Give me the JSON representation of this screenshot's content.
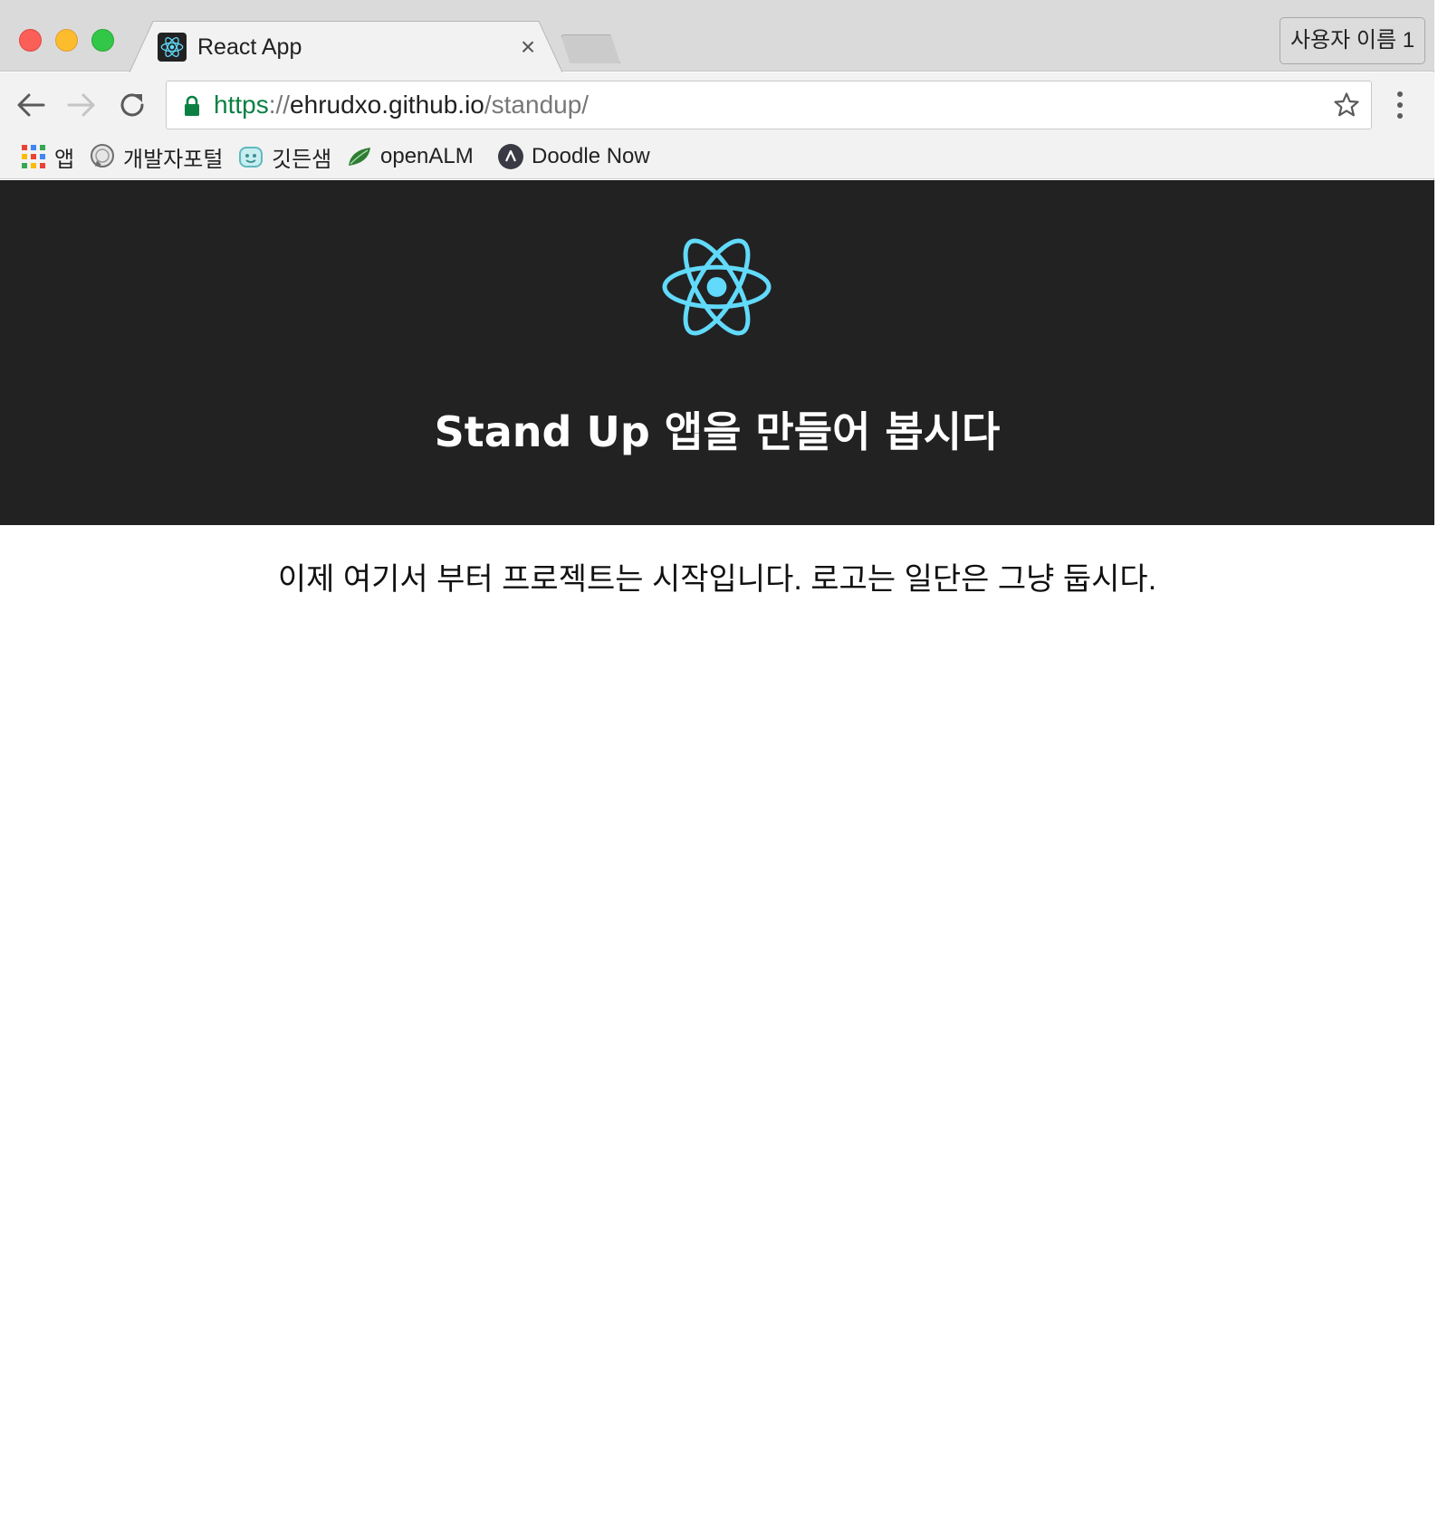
{
  "browser": {
    "tab": {
      "title": "React App",
      "close_symbol": "×"
    },
    "profile": {
      "label": "사용자 이름 1"
    },
    "address_bar": {
      "scheme": "https",
      "separator": "://",
      "host": "ehrudxo.github.io",
      "path": "/standup/"
    },
    "bookmarks": [
      {
        "label": "앱",
        "icon": "apps-grid-icon"
      },
      {
        "label": "개발자포털",
        "icon": "chat-bubble-icon"
      },
      {
        "label": "깃든샘",
        "icon": "robot-face-icon"
      },
      {
        "label": "openALM",
        "icon": "leaf-icon"
      },
      {
        "label": "Doodle Now",
        "icon": "doodle-logo-icon"
      }
    ],
    "colors": {
      "secure_green": "#0b8043",
      "react_blue": "#61dafb",
      "header_bg": "#222222"
    }
  },
  "page": {
    "header_title": "Stand Up 앱을 만들어 봅시다",
    "intro": "이제 여기서 부터 프로젝트는 시작입니다. 로고는 일단은 그냥 둡시다."
  }
}
